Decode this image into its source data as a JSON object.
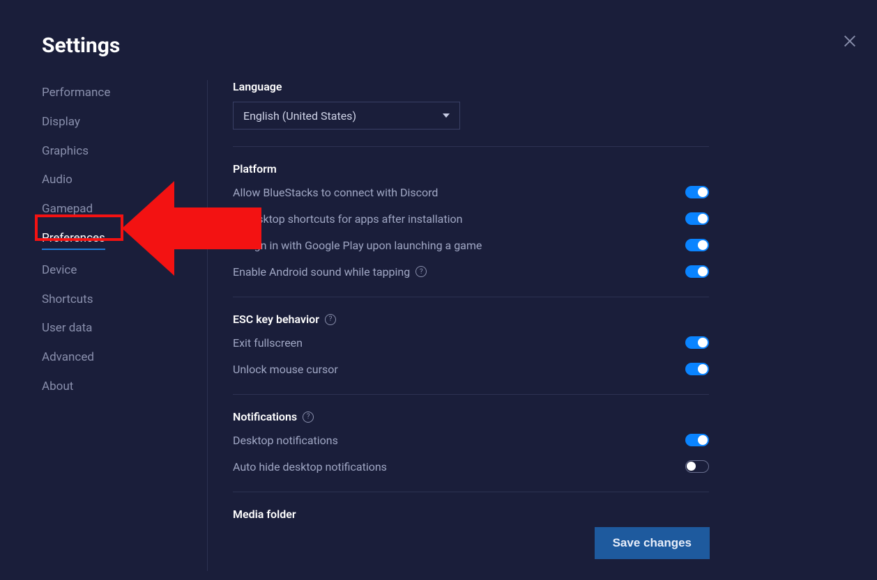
{
  "title": "Settings",
  "sidebar": {
    "items": [
      {
        "label": "Performance"
      },
      {
        "label": "Display"
      },
      {
        "label": "Graphics"
      },
      {
        "label": "Audio"
      },
      {
        "label": "Gamepad"
      },
      {
        "label": "Preferences"
      },
      {
        "label": "Device"
      },
      {
        "label": "Shortcuts"
      },
      {
        "label": "User data"
      },
      {
        "label": "Advanced"
      },
      {
        "label": "About"
      }
    ],
    "active_index": 5
  },
  "language": {
    "heading": "Language",
    "selected": "English (United States)"
  },
  "platform": {
    "heading": "Platform",
    "rows": [
      {
        "label": "Allow BlueStacks to connect with Discord",
        "on": true,
        "help": false
      },
      {
        "label": "te desktop shortcuts for apps after installation",
        "on": true,
        "help": false
      },
      {
        "label": "or sign in with Google Play upon launching a game",
        "on": true,
        "help": false
      },
      {
        "label": "Enable Android sound while tapping",
        "on": true,
        "help": true
      }
    ]
  },
  "esc": {
    "heading": "ESC key behavior",
    "rows": [
      {
        "label": "Exit fullscreen",
        "on": true
      },
      {
        "label": "Unlock mouse cursor",
        "on": true
      }
    ]
  },
  "notifications": {
    "heading": "Notifications",
    "rows": [
      {
        "label": "Desktop notifications",
        "on": true
      },
      {
        "label": "Auto hide desktop notifications",
        "on": false
      }
    ]
  },
  "media": {
    "heading": "Media folder"
  },
  "save_button": "Save changes",
  "colors": {
    "bg": "#1a1e3a",
    "accent": "#0a84ff",
    "highlight": "#f31212"
  }
}
